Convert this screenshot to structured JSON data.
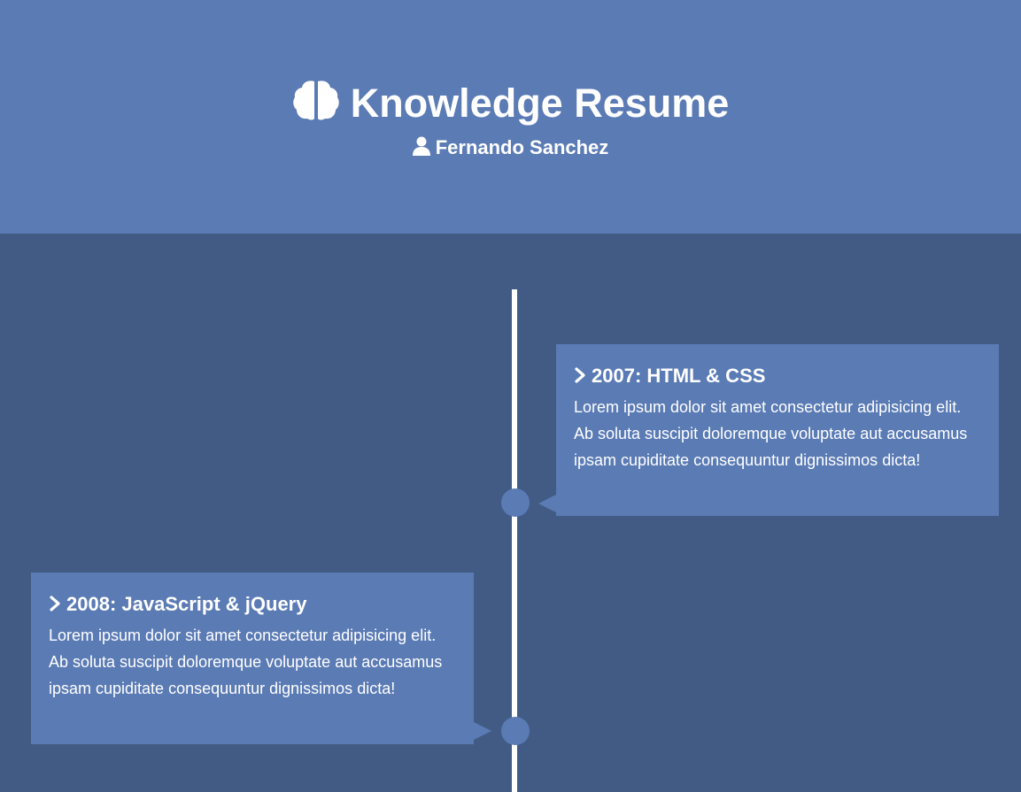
{
  "header": {
    "title": "Knowledge Resume",
    "title_icon": "brain-icon",
    "subtitle": "Fernando Sanchez",
    "subtitle_icon": "user-icon"
  },
  "timeline": {
    "items": [
      {
        "title": "2007: HTML & CSS",
        "body": "Lorem ipsum dolor sit amet consectetur adipisicing elit. Ab soluta suscipit doloremque voluptate aut accusamus ipsam cupiditate consequuntur dignissimos dicta!",
        "icon": "chevron-right-icon"
      },
      {
        "title": "2008: JavaScript & jQuery",
        "body": "Lorem ipsum dolor sit amet consectetur adipisicing elit. Ab soluta suscipit doloremque voluptate aut accusamus ipsam cupiditate consequuntur dignissimos dicta!",
        "icon": "chevron-right-icon"
      }
    ]
  },
  "colors": {
    "background": "#415b84",
    "accent": "#5b7bb5",
    "text": "#ffffff"
  }
}
